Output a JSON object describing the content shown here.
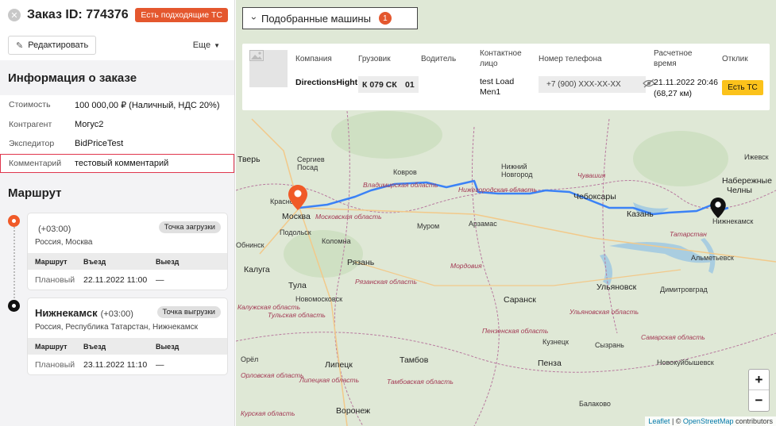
{
  "order": {
    "title": "Заказ ID: 774376",
    "badge": "Есть подходящие ТС",
    "edit_label": "Редактировать",
    "more_label": "Еще"
  },
  "info": {
    "title": "Информация о заказе",
    "rows": [
      {
        "key": "Стоимость",
        "value": "100 000,00 ₽ (Наличный, НДС 20%)"
      },
      {
        "key": "Контрагент",
        "value": "Могус2"
      },
      {
        "key": "Экспедитор",
        "value": "BidPriceTest"
      },
      {
        "key": "Комментарий",
        "value": "тестовый комментарий"
      }
    ]
  },
  "route": {
    "title": "Маршрут",
    "points": [
      {
        "city": "",
        "tz": "(+03:00)",
        "address": "Россия, Москва",
        "badge": "Точка загрузки",
        "headers": [
          "Маршрут",
          "Въезд",
          "Выезд"
        ],
        "row": [
          "Плановый",
          "22.11.2022 11:00",
          "—"
        ]
      },
      {
        "city": "Нижнекамск",
        "tz": "(+03:00)",
        "address": "Россия, Республика Татарстан, Нижнекамск",
        "badge": "Точка выгрузки",
        "headers": [
          "Маршрут",
          "Въезд",
          "Выезд"
        ],
        "row": [
          "Плановый",
          "23.11.2022 11:10",
          "—"
        ]
      }
    ]
  },
  "matched": {
    "label": "Подобранные машины",
    "count": "1",
    "headers": {
      "company": "Компания",
      "truck": "Грузовик",
      "driver": "Водитель",
      "contact": "Контактное лицо",
      "phone": "Номер телефона",
      "time": "Расчетное время",
      "response": "Отклик"
    },
    "row": {
      "company": "DirectionsHight",
      "plate_number": "К 079 СК",
      "plate_region": "01",
      "contact": "test Load Men1",
      "phone": "+7 (900) XXX-XX-XX",
      "time": "21.11.2022 20:46 (68,27 км)",
      "response": "Есть ТС"
    }
  },
  "map": {
    "labels": {
      "tver": "Тверь",
      "sergiev": "Сергиев",
      "posad": "Посад",
      "kovrov": "Ковров",
      "nizhny": "Нижний",
      "novgorod": "Новгород",
      "cheboksary": "Чебоксары",
      "kazan": "Казань",
      "naberezhnye": "Набережные",
      "chelny": "Челны",
      "nizhnekamsk": "Нижнекамск",
      "izhevsk": "Ижевск",
      "moskva": "Москва",
      "krasnogorsk": "Красно",
      "podolsk": "Подольск",
      "obninsk": "Обнинск",
      "murom": "Муром",
      "arzamas": "Арзамас",
      "ryazan": "Рязань",
      "kaluga": "Калуга",
      "tula": "Тула",
      "novomoskovsk": "Новомосковск",
      "saransk": "Саранск",
      "ulyanovsk": "Ульяновск",
      "dimitrovgrad": "Димитровград",
      "almetyevsk": "Альметьевск",
      "kolomna": "Коломна",
      "penza": "Пенза",
      "oryol": "Орёл",
      "lipetsk": "Липецк",
      "tambov": "Тамбов",
      "voronezh": "Воронеж",
      "balakovo": "Балаково",
      "syzran": "Сызрань",
      "kuznetsk": "Кузнецк",
      "novokuibyshevsk": "Новокуйбышевск",
      "vladimir_obl": "Владимирская область",
      "moscow_obl": "Московская область",
      "ryazan_obl": "Рязанская область",
      "tula_obl": "Тульская область",
      "nizhny_obl": "Нижегородская область",
      "penza_obl": "Пензенская область",
      "tambov_obl": "Тамбовская область",
      "lipetsk_obl": "Липецкая область",
      "samara_obl": "Самарская область",
      "tatarstan": "Татарстан",
      "kursk_obl": "Курская область",
      "ulyanovsk_obl": "Ульяновская область",
      "mordovia": "Мордовия",
      "chuvashia": "Чувашия",
      "oryol_obl": "Орловская область",
      "kaluga_obl": "Калужская область"
    },
    "zoom_in": "+",
    "zoom_out": "−",
    "attr_leaflet": "Leaflet",
    "attr_sep": " | © ",
    "attr_osm": "OpenStreetMap",
    "attr_tail": " contributors"
  },
  "colors": {
    "accent": "#e4572e",
    "route": "#3b82f6",
    "yellow": "#fbc21b"
  }
}
